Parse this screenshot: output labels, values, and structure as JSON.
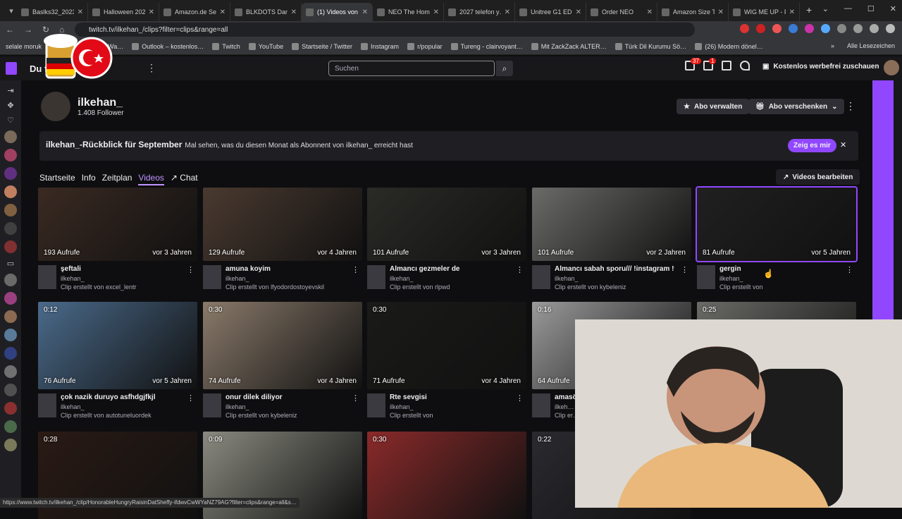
{
  "browser": {
    "tabs": [
      {
        "title": "Baslks32_2023",
        "active": false
      },
      {
        "title": "Halloween 202…",
        "active": false
      },
      {
        "title": "Amazon.de Se…",
        "active": false
      },
      {
        "title": "BLKDOTS Dam…",
        "active": false
      },
      {
        "title": "(1) Videos von",
        "active": true
      },
      {
        "title": "NEO The Hom…",
        "active": false
      },
      {
        "title": "2027 telefon y…",
        "active": false
      },
      {
        "title": "Unitree G1 ED…",
        "active": false
      },
      {
        "title": "Order NEO",
        "active": false
      },
      {
        "title": "Amazon Size T…",
        "active": false
      },
      {
        "title": "WIG ME UP - F…",
        "active": false
      }
    ],
    "url": "twitch.tv/ilkehan_/clips?filter=clips&range=all",
    "bookmarks": [
      "selale moruk",
      "ilkehan Stream - Wa…",
      "Outlook – kostenlos…",
      "Twitch",
      "YouTube",
      "Startseite / Twitter",
      "Instagram",
      "r/popular",
      "Tureng - clairvoyant…",
      "Mit ZackZack ALTER…",
      "Türk Dil Kurumu Sö…",
      "(26) Modern dönel…"
    ],
    "all_bookmarks": "Alle Lesezeichen",
    "status_url": "https://www.twitch.tv/ilkehan_/clip/HonorableHungryRaisinDatSheffy-ifdwvCwWYaNZ79AG?filter=clips&range=all&s…"
  },
  "topnav": {
    "browse": "Du f… suchen",
    "search_placeholder": "Suchen",
    "badge_inbox": "37",
    "badge_whispers": "1",
    "adfree": "Kostenlos werbefrei zuschauen"
  },
  "channel": {
    "name": "ilkehan_",
    "followers": "1.408 Follower",
    "abo_manage": "Abo verwalten",
    "abo_gift": "Abo verschenken"
  },
  "recap": {
    "title": "ilkehan_-Rückblick für September",
    "text": "Mal sehen, was du diesen Monat als Abonnent von ilkehan_ erreicht hast",
    "button": "Zeig es mir"
  },
  "tabs": [
    "Startseite",
    "Info",
    "Zeitplan",
    "Videos",
    "Chat"
  ],
  "edit_videos": "Videos bearbeiten",
  "clips": [
    {
      "duration": "",
      "views": "193 Aufrufe",
      "age": "vor 3 Jahren",
      "title": "şeftali",
      "channel": "ilkehan_",
      "by": "Clip erstellt von excel_lentr",
      "color": "#3a2a22"
    },
    {
      "duration": "",
      "views": "129 Aufrufe",
      "age": "vor 4 Jahren",
      "title": "amuna koyim",
      "channel": "ilkehan_",
      "by": "Clip erstellt von lfyodordostoyevskil",
      "color": "#4a3a30"
    },
    {
      "duration": "",
      "views": "101 Aufrufe",
      "age": "vor 3 Jahren",
      "title": "Almancı gezmeler de",
      "channel": "ilkehan_",
      "by": "Clip erstellt von rlpwd",
      "color": "#2a2a26"
    },
    {
      "duration": "",
      "views": "101 Aufrufe",
      "age": "vor 2 Jahren",
      "title": "Almancı sabah sporu/// !instagram !t…",
      "channel": "ilkehan_",
      "by": "Clip erstellt von kybeleniz",
      "color": "#6a6a68"
    },
    {
      "duration": "",
      "views": "81 Aufrufe",
      "age": "vor 5 Jahren",
      "title": "gergin",
      "channel": "ilkehan_",
      "by": "Clip erstellt von",
      "color": "#202020"
    },
    {
      "duration": "0:12",
      "views": "76 Aufrufe",
      "age": "vor 5 Jahren",
      "title": "çok nazik duruyo asfhdgjfkjl",
      "channel": "ilkehan_",
      "by": "Clip erstellt von autotuneluordek",
      "color": "#4a6a8a"
    },
    {
      "duration": "0:30",
      "views": "74 Aufrufe",
      "age": "vor 4 Jahren",
      "title": "onur dilek diliyor",
      "channel": "ilkehan_",
      "by": "Clip erstellt von kybeleniz",
      "color": "#8a7a6a"
    },
    {
      "duration": "0:30",
      "views": "71 Aufrufe",
      "age": "vor 4 Jahren",
      "title": "Rte sevgisi",
      "channel": "ilkehan_",
      "by": "Clip erstellt von",
      "color": "#1a1a18"
    },
    {
      "duration": "0:16",
      "views": "64 Aufrufe",
      "age": "",
      "title": "amasö…",
      "channel": "ilkeh…",
      "by": "Clip er…",
      "color": "#9a9a9a"
    },
    {
      "duration": "0:25",
      "views": "",
      "age": "",
      "title": "",
      "channel": "",
      "by": "",
      "color": "#6a6a66"
    },
    {
      "duration": "0:28",
      "views": "",
      "age": "",
      "title": "",
      "channel": "",
      "by": "",
      "color": "#2a1a14"
    },
    {
      "duration": "0:09",
      "views": "",
      "age": "",
      "title": "",
      "channel": "",
      "by": "",
      "color": "#8a8a80"
    },
    {
      "duration": "0:30",
      "views": "",
      "age": "",
      "title": "",
      "channel": "",
      "by": "",
      "color": "#8a2a2a"
    },
    {
      "duration": "0:22",
      "views": "",
      "age": "",
      "title": "",
      "channel": "",
      "by": "",
      "color": "#2a2a30"
    }
  ]
}
